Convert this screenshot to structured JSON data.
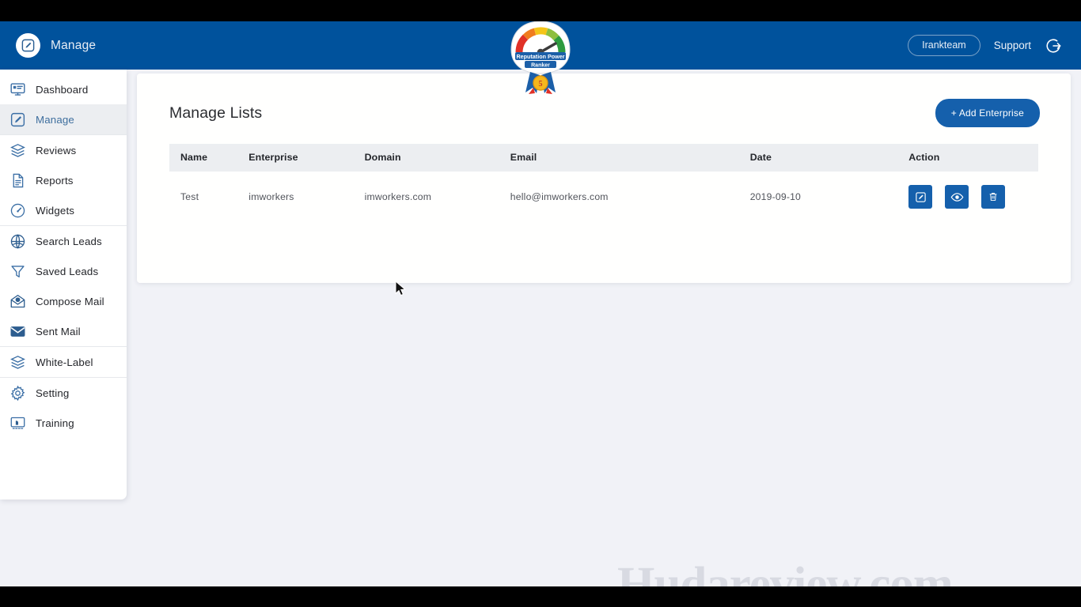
{
  "header": {
    "brand_icon": "pencil-square-icon",
    "brand_title": "Manage",
    "logo_alt": "Reputation Power Ranker",
    "logo_line1": "Reputation Power",
    "logo_line2": "Ranker",
    "user_name": "Irankteam",
    "support_label": "Support",
    "logout_icon": "logout-icon",
    "bg_color": "#00529c"
  },
  "sidebar": {
    "groups": [
      {
        "items": [
          {
            "label": "Dashboard",
            "icon": "monitor-icon",
            "active": false
          },
          {
            "label": "Manage",
            "icon": "pencil-square-icon",
            "active": true
          }
        ]
      },
      {
        "items": [
          {
            "label": "Reviews",
            "icon": "layers-icon",
            "active": false
          },
          {
            "label": "Reports",
            "icon": "document-icon",
            "active": false
          },
          {
            "label": "Widgets",
            "icon": "gauge-icon",
            "active": false
          }
        ]
      },
      {
        "items": [
          {
            "label": "Search Leads",
            "icon": "globe-search-icon",
            "active": false
          },
          {
            "label": "Saved Leads",
            "icon": "funnel-icon",
            "active": false
          },
          {
            "label": "Compose Mail",
            "icon": "open-envelope-icon",
            "active": false
          },
          {
            "label": "Sent Mail",
            "icon": "envelope-icon",
            "active": false
          }
        ]
      },
      {
        "items": [
          {
            "label": "White-Label",
            "icon": "layers-icon",
            "active": false
          }
        ]
      },
      {
        "items": [
          {
            "label": "Setting",
            "icon": "gear-icon",
            "active": false
          },
          {
            "label": "Training",
            "icon": "presentation-icon",
            "active": false
          }
        ]
      }
    ]
  },
  "main": {
    "title": "Manage Lists",
    "add_button_label": "+ Add Enterprise",
    "accent_color": "#1560ac",
    "table": {
      "columns": [
        "Name",
        "Enterprise",
        "Domain",
        "Email",
        "Date",
        "Action"
      ],
      "rows": [
        {
          "name": "Test",
          "enterprise": "imworkers",
          "domain": "imworkers.com",
          "email": "hello@imworkers.com",
          "date": "2019-09-10",
          "actions": [
            "edit-icon",
            "view-icon",
            "delete-icon"
          ]
        }
      ]
    }
  },
  "watermark": {
    "text": "Hudareview.com"
  }
}
